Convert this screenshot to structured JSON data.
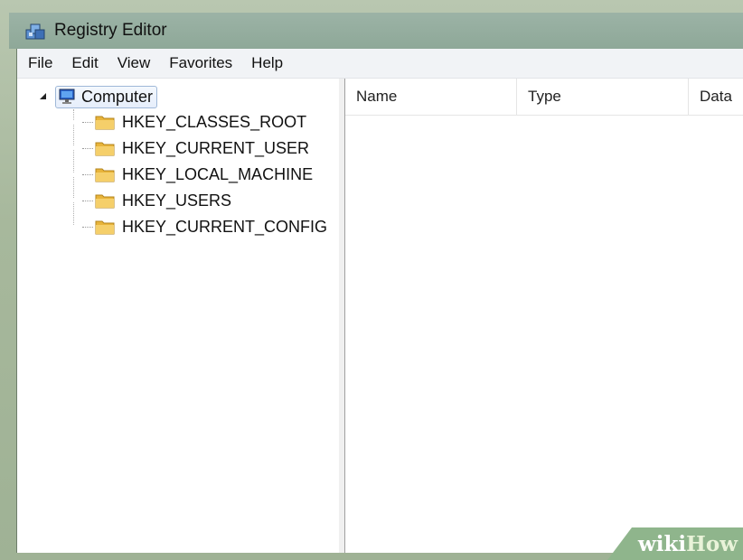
{
  "window": {
    "title": "Registry Editor"
  },
  "menu": [
    "File",
    "Edit",
    "View",
    "Favorites",
    "Help"
  ],
  "tree": {
    "root": "Computer",
    "children": [
      "HKEY_CLASSES_ROOT",
      "HKEY_CURRENT_USER",
      "HKEY_LOCAL_MACHINE",
      "HKEY_USERS",
      "HKEY_CURRENT_CONFIG"
    ]
  },
  "list": {
    "columns": [
      "Name",
      "Type",
      "Data"
    ]
  },
  "watermark": {
    "part1": "wiki",
    "part2": "How"
  },
  "icons": {
    "app": "registry-editor-icon",
    "root": "computer-icon",
    "child": "folder-icon"
  },
  "colors": {
    "frame": "#a7b89c",
    "folder": "#e8b43a",
    "watermark_bg": "#8fb58c"
  }
}
